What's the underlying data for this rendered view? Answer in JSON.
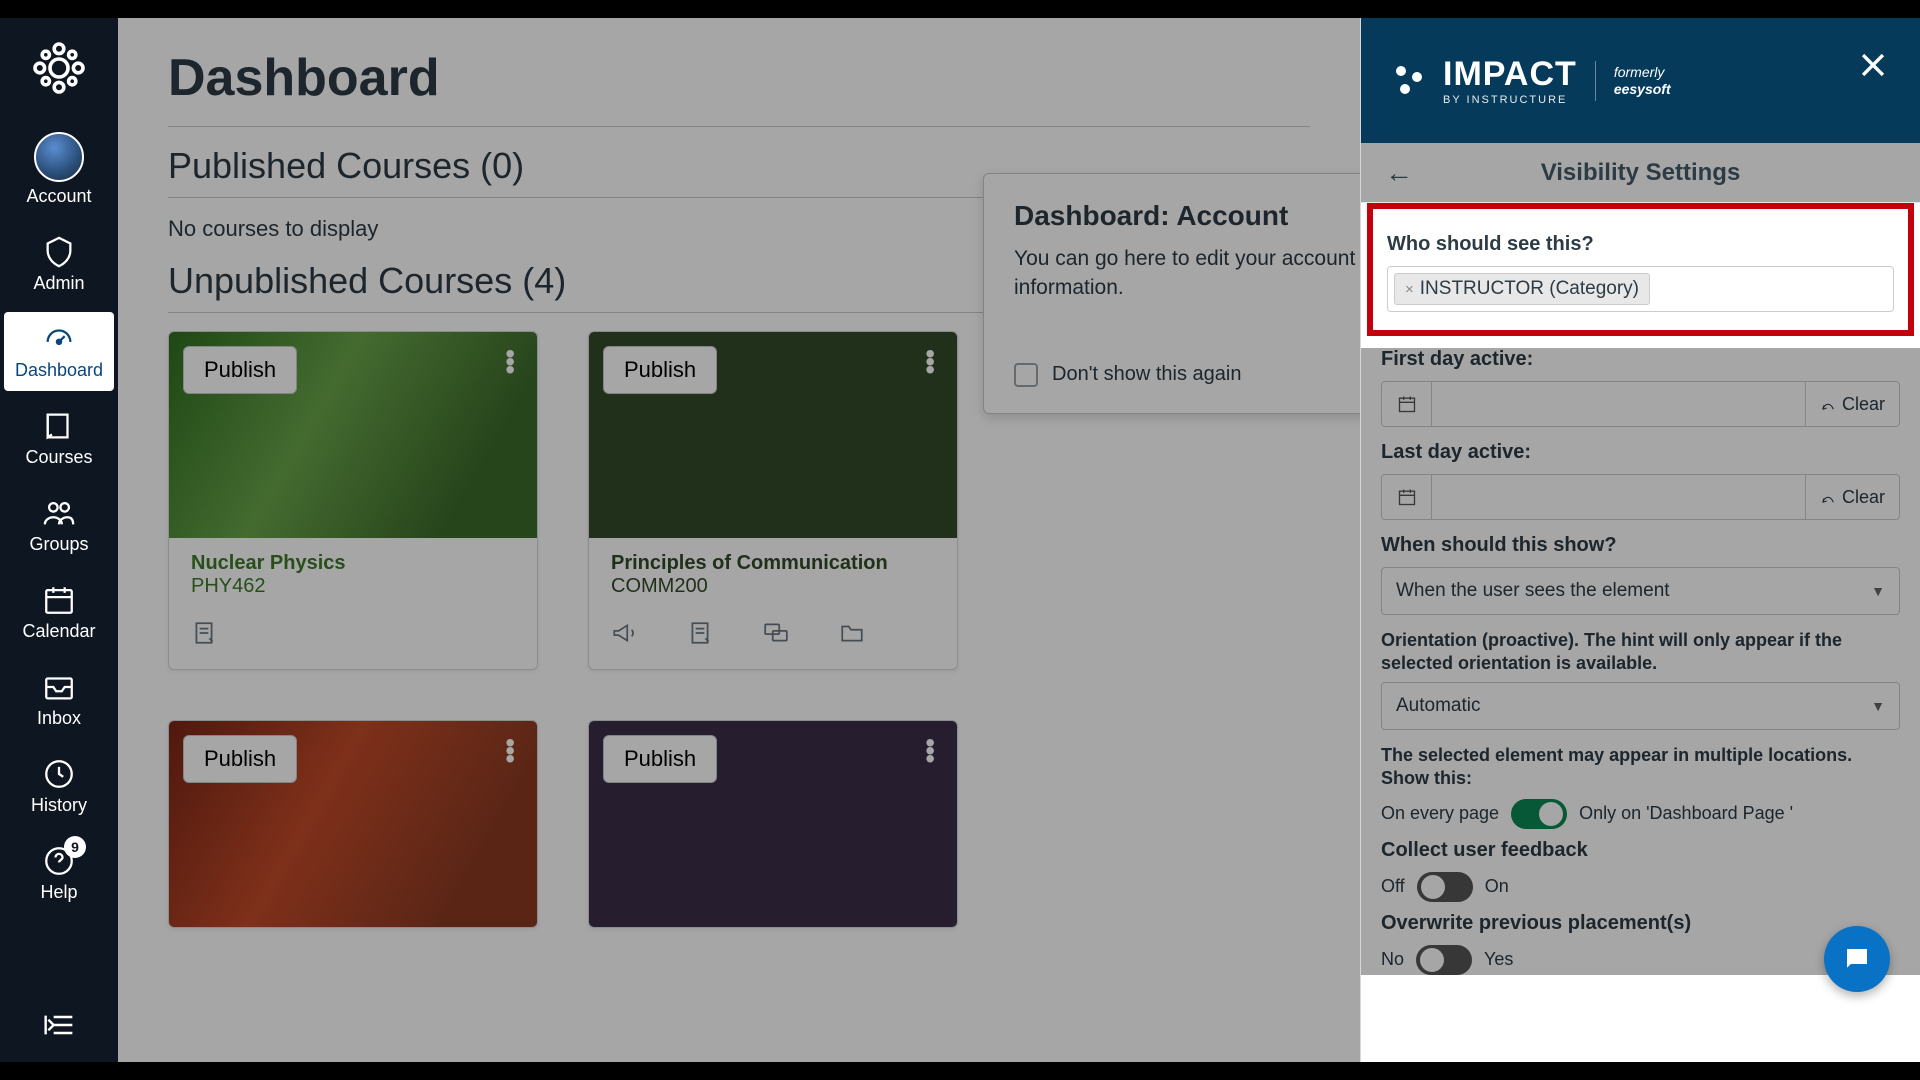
{
  "nav": {
    "account": "Account",
    "admin": "Admin",
    "dashboard": "Dashboard",
    "courses": "Courses",
    "groups": "Groups",
    "calendar": "Calendar",
    "inbox": "Inbox",
    "history": "History",
    "help": "Help",
    "help_badge": "9"
  },
  "main": {
    "title": "Dashboard",
    "published_title": "Published Courses (0)",
    "no_courses": "No courses to display",
    "unpublished_title": "Unpublished Courses (4)",
    "publish_label": "Publish",
    "cards": [
      {
        "title": "Nuclear Physics",
        "code": "PHY462"
      },
      {
        "title": "Principles of Communication",
        "code": "COMM200"
      }
    ]
  },
  "popover": {
    "title": "Dashboard: Account",
    "body": "You can go here to edit your account information.",
    "dont_show": "Don't show this again"
  },
  "panel": {
    "brand_big": "IMPACT",
    "brand_small": "BY INSTRUCTURE",
    "formerly": "formerly",
    "eesysoft": "eesysoft",
    "header_title": "Visibility Settings",
    "who_label": "Who should see this?",
    "tag_text": "INSTRUCTOR (Category)",
    "first_day": "First day active:",
    "last_day": "Last day active:",
    "clear": "Clear",
    "when_label": "When should this show?",
    "when_value": "When the user sees the element",
    "orientation_label": "Orientation (proactive). The hint will only appear if the selected orientation is available.",
    "orientation_value": "Automatic",
    "multi_loc": "The selected element may appear in multiple locations. Show this:",
    "every_page": "On every page",
    "only_on": "Only on 'Dashboard Page '",
    "feedback_label": "Collect user feedback",
    "off": "Off",
    "on": "On",
    "overwrite_label": "Overwrite previous placement(s)",
    "no": "No",
    "yes": "Yes"
  }
}
